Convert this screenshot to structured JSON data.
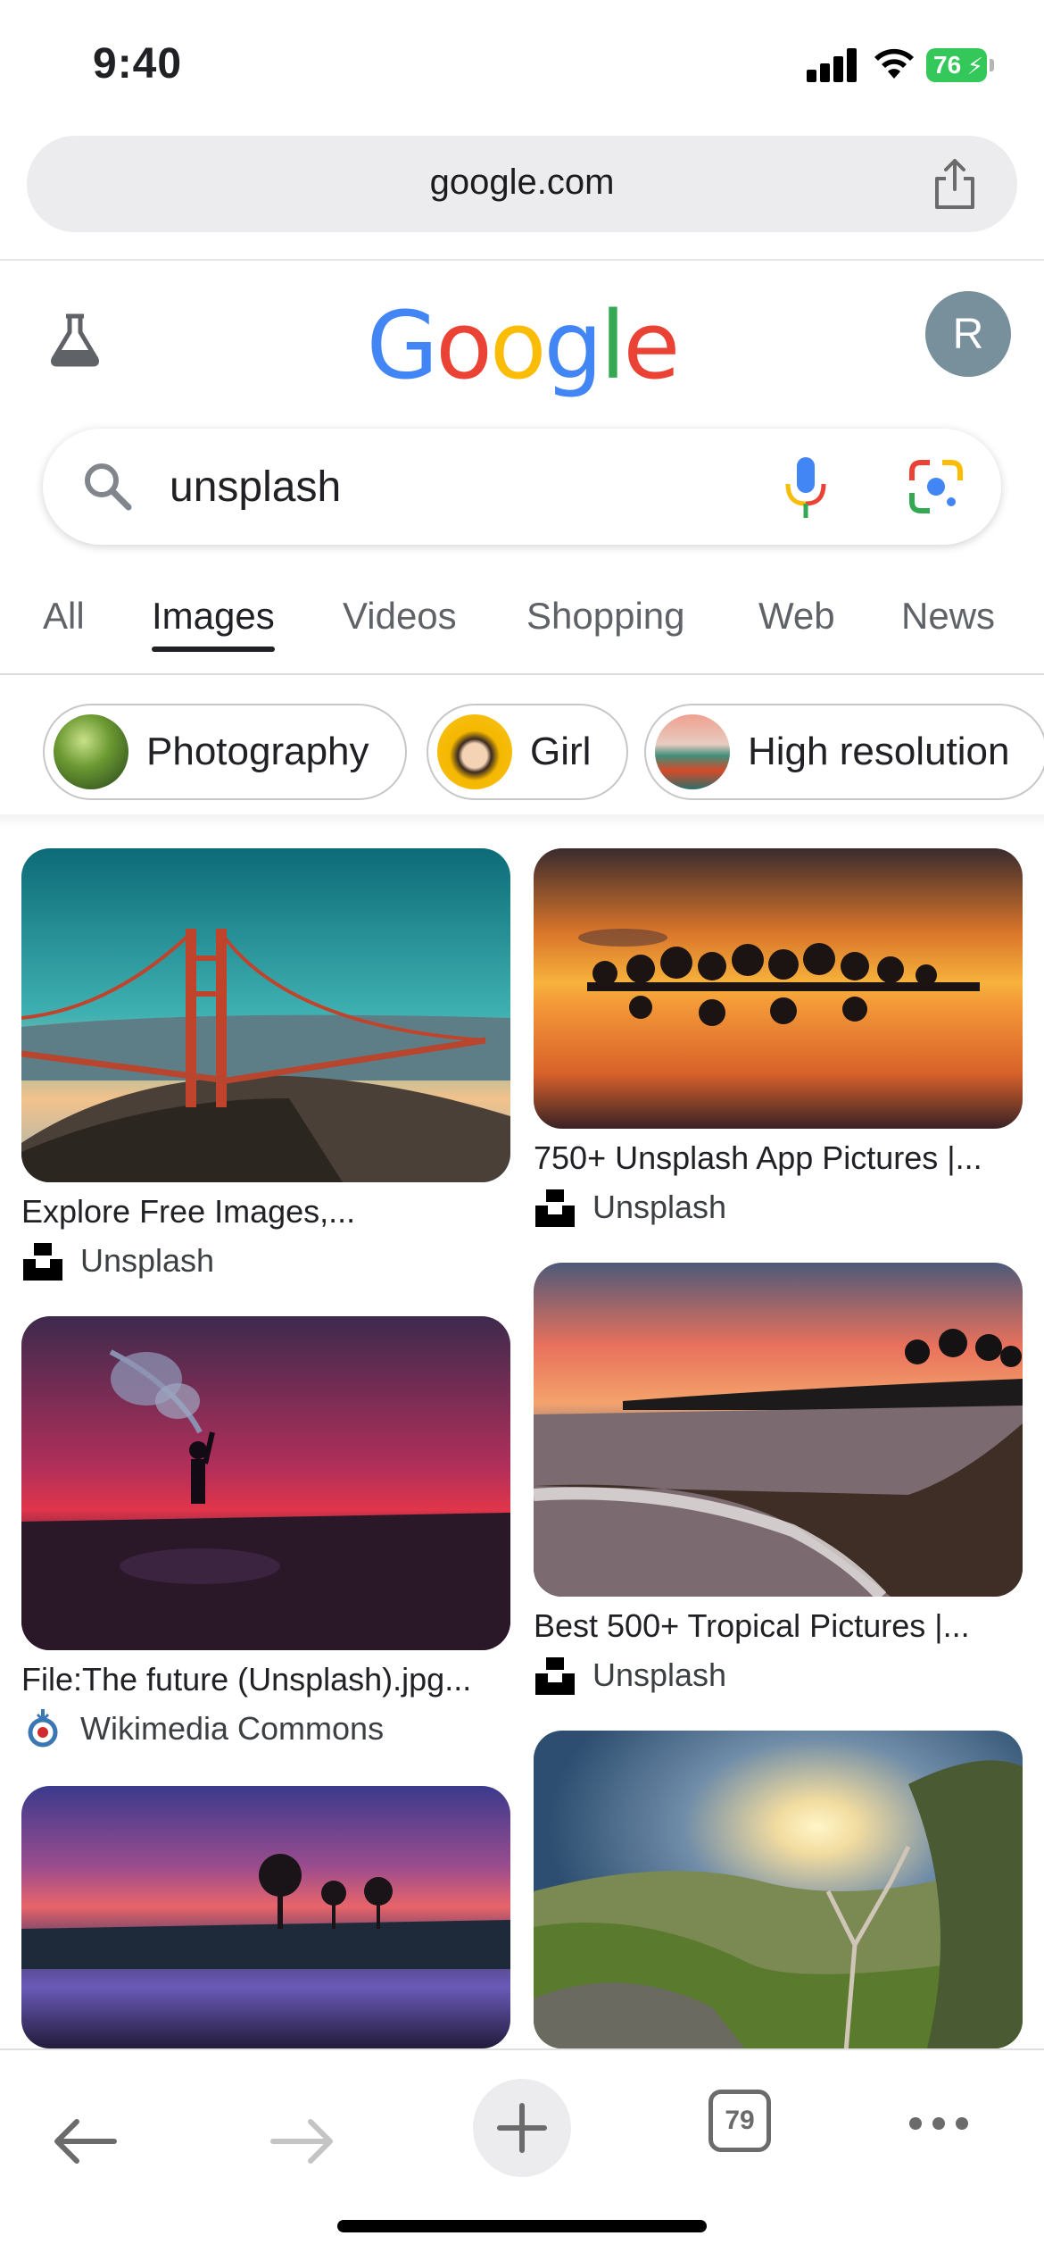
{
  "status_bar": {
    "time": "9:40",
    "battery": "76"
  },
  "browser": {
    "url": "google.com",
    "tab_count": "79"
  },
  "google": {
    "logo_letters": [
      "G",
      "o",
      "o",
      "g",
      "l",
      "e"
    ],
    "logo_colors": [
      "#4285F4",
      "#EA4335",
      "#FBBC05",
      "#4285F4",
      "#34A853",
      "#EA4335"
    ],
    "avatar_initial": "R",
    "search_query": "unsplash"
  },
  "tabs": [
    "All",
    "Images",
    "Videos",
    "Shopping",
    "Web",
    "News"
  ],
  "active_tab": "Images",
  "chips": [
    "Photography",
    "Girl",
    "High resolution"
  ],
  "results": [
    {
      "title": "Explore Free Images,...",
      "source": "Unsplash",
      "source_icon": "unsplash-icon"
    },
    {
      "title": "750+ Unsplash App Pictures |...",
      "source": "Unsplash",
      "source_icon": "unsplash-icon"
    },
    {
      "title": "File:The future (Unsplash).jpg...",
      "source": "Wikimedia Commons",
      "source_icon": "wikimedia-icon"
    },
    {
      "title": "Best 500+ Tropical Pictures |...",
      "source": "Unsplash",
      "source_icon": "unsplash-icon"
    },
    {
      "title": "",
      "source": "",
      "source_icon": ""
    },
    {
      "title": "",
      "source": "",
      "source_icon": ""
    }
  ],
  "colors": {
    "battery": "#34c759",
    "avatar": "#78909c",
    "active_tab_underline": "#202124"
  }
}
